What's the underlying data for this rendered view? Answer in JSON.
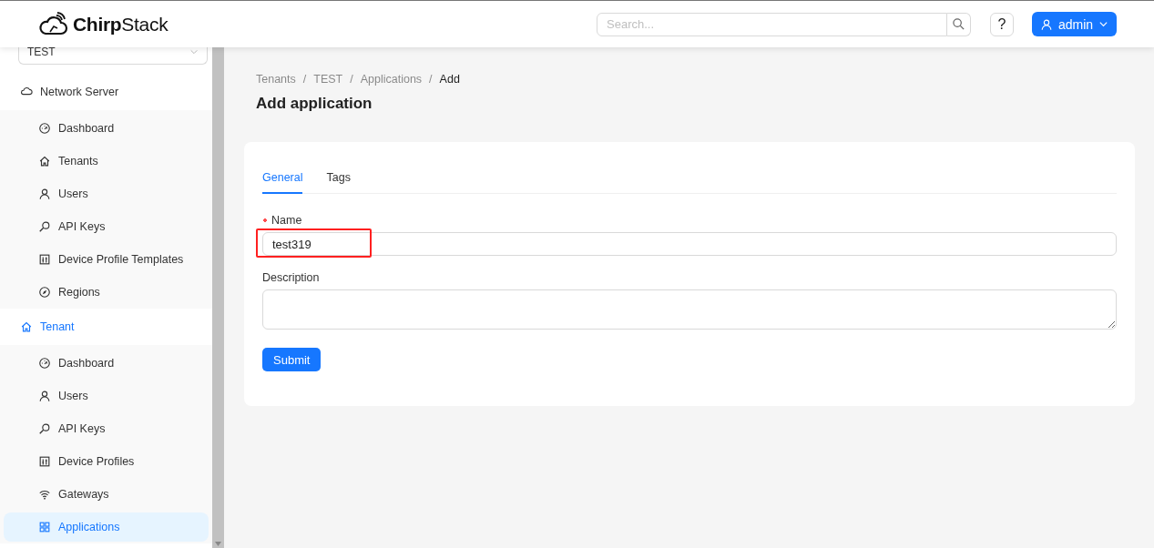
{
  "header": {
    "logo_text": "**Chirp**Stack",
    "search": {
      "placeholder": "Search..."
    },
    "help_label": "?",
    "user_label": "admin"
  },
  "sidebar": {
    "tenant_select": "TEST",
    "sections": [
      {
        "label": "Network Server",
        "selected": false,
        "items": [
          {
            "label": "Dashboard",
            "selected": false
          },
          {
            "label": "Tenants",
            "selected": false
          },
          {
            "label": "Users",
            "selected": false
          },
          {
            "label": "API Keys",
            "selected": false
          },
          {
            "label": "Device Profile Templates",
            "selected": false
          },
          {
            "label": "Regions",
            "selected": false
          }
        ]
      },
      {
        "label": "Tenant",
        "selected": true,
        "items": [
          {
            "label": "Dashboard",
            "selected": false
          },
          {
            "label": "Users",
            "selected": false
          },
          {
            "label": "API Keys",
            "selected": false
          },
          {
            "label": "Device Profiles",
            "selected": false
          },
          {
            "label": "Gateways",
            "selected": false
          },
          {
            "label": "Applications",
            "selected": true
          }
        ]
      }
    ]
  },
  "breadcrumb": {
    "separator": "/",
    "items": [
      "Tenants",
      "TEST",
      "Applications",
      "Add"
    ]
  },
  "page_title": "Add application",
  "form": {
    "tabs": [
      {
        "label": "General",
        "selected": true
      },
      {
        "label": "Tags",
        "selected": false
      }
    ],
    "fields": [
      {
        "kind": "input",
        "label": "Name",
        "required": true,
        "value": "test319"
      },
      {
        "kind": "textarea",
        "label": "Description",
        "required": false
      }
    ],
    "submit": "Submit"
  }
}
